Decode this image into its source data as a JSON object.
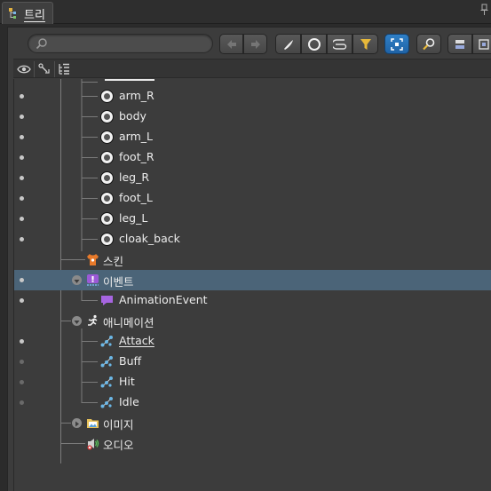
{
  "window": {
    "tab_label": "트리",
    "tab_icon": "tree-icon",
    "pin_icon": "pin-icon"
  },
  "toolbar": {
    "search_placeholder": "",
    "buttons": [
      {
        "name": "back-button",
        "icon": "arrow-left-icon",
        "state": "disabled"
      },
      {
        "name": "forward-button",
        "icon": "arrow-right-icon",
        "state": "disabled"
      },
      {
        "name": "bone-filter-button",
        "icon": "bone-brush-icon"
      },
      {
        "name": "slot-filter-button",
        "icon": "circle-icon"
      },
      {
        "name": "attachment-filter-button",
        "icon": "paperclip-icon"
      },
      {
        "name": "filter-button",
        "icon": "funnel-icon"
      },
      {
        "name": "focus-button",
        "icon": "focus-frame-icon",
        "state": "active"
      },
      {
        "name": "find-button",
        "icon": "magnifier-key-icon"
      },
      {
        "name": "collapse-button",
        "icon": "stack-icon"
      },
      {
        "name": "expand-button",
        "icon": "expand-icon"
      }
    ],
    "colors": {
      "active": "#2f7fc6",
      "funnel": "#e8b93a"
    }
  },
  "header": {
    "columns": [
      {
        "name": "visibility-column",
        "icon": "eye-icon"
      },
      {
        "name": "keys-column",
        "icon": "bone-link-icon"
      },
      {
        "name": "tree-column",
        "icon": "tree-list-icon"
      }
    ]
  },
  "tree": {
    "selection_color": "#4b6478",
    "rows": [
      {
        "label": "arm_R",
        "type": "bone",
        "visible": true
      },
      {
        "label": "body",
        "type": "bone",
        "visible": true
      },
      {
        "label": "arm_L",
        "type": "bone",
        "visible": true
      },
      {
        "label": "foot_R",
        "type": "bone",
        "visible": true
      },
      {
        "label": "leg_R",
        "type": "bone",
        "visible": true
      },
      {
        "label": "foot_L",
        "type": "bone",
        "visible": true
      },
      {
        "label": "leg_L",
        "type": "bone",
        "visible": true
      },
      {
        "label": "cloak_back",
        "type": "bone",
        "visible": true
      },
      {
        "label": "스킨",
        "type": "skins-folder",
        "visible": false
      },
      {
        "label": "이벤트",
        "type": "events-folder",
        "visible": true,
        "selected": true,
        "expanded": true
      },
      {
        "label": "AnimationEvent",
        "type": "event",
        "visible": true
      },
      {
        "label": "애니메이션",
        "type": "animations-folder",
        "visible": false,
        "expanded": true
      },
      {
        "label": "Attack",
        "type": "animation",
        "visible": true,
        "active": true
      },
      {
        "label": "Buff",
        "type": "animation",
        "visible": false
      },
      {
        "label": "Hit",
        "type": "animation",
        "visible": false
      },
      {
        "label": "Idle",
        "type": "animation",
        "visible": false
      },
      {
        "label": "이미지",
        "type": "images-folder",
        "visible": false,
        "expanded": false
      },
      {
        "label": "오디오",
        "type": "audio-folder",
        "visible": false
      }
    ]
  }
}
